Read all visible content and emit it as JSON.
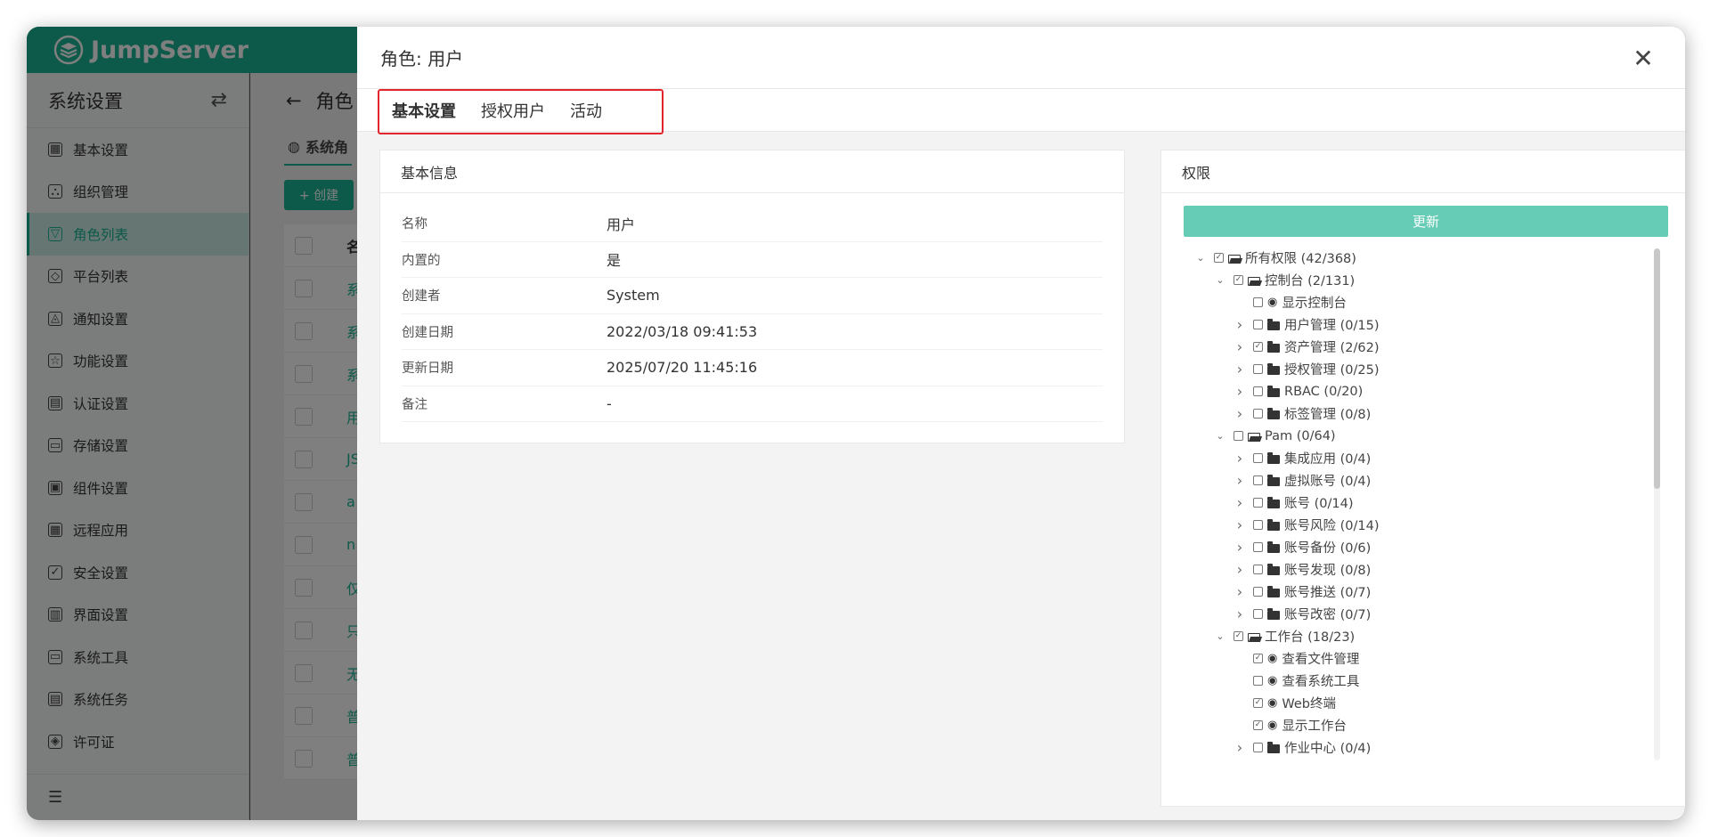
{
  "app": {
    "brand": "JumpServer"
  },
  "sidebar": {
    "title": "系统设置",
    "switch_icon": "swap-icon",
    "items": [
      {
        "label": "基本设置",
        "icon": "grid-icon",
        "active": false
      },
      {
        "label": "组织管理",
        "icon": "org-icon",
        "active": false
      },
      {
        "label": "角色列表",
        "icon": "shirt-icon",
        "active": true
      },
      {
        "label": "平台列表",
        "icon": "cube-icon",
        "active": false
      },
      {
        "label": "通知设置",
        "icon": "bell-icon",
        "active": false
      },
      {
        "label": "功能设置",
        "icon": "star-icon",
        "active": false
      },
      {
        "label": "认证设置",
        "icon": "card-icon",
        "active": false
      },
      {
        "label": "存储设置",
        "icon": "inbox-icon",
        "active": false
      },
      {
        "label": "组件设置",
        "icon": "monitor-icon",
        "active": false
      },
      {
        "label": "远程应用",
        "icon": "apps-icon",
        "active": false
      },
      {
        "label": "安全设置",
        "icon": "shield-icon",
        "active": false
      },
      {
        "label": "界面设置",
        "icon": "layout-icon",
        "active": false
      },
      {
        "label": "系统工具",
        "icon": "toolbox-icon",
        "active": false
      },
      {
        "label": "系统任务",
        "icon": "task-icon",
        "active": false
      },
      {
        "label": "许可证",
        "icon": "license-icon",
        "active": false
      }
    ]
  },
  "main": {
    "back_title": "角色",
    "tab_label": "系统角",
    "create_label": "+ 创建",
    "table_first_chars": [
      "系",
      "系",
      "系",
      "用",
      "JS",
      "a",
      "n",
      "仅",
      "只",
      "无",
      "普",
      "普"
    ],
    "table_header_first_char": "名"
  },
  "drawer": {
    "title": "角色: 用户",
    "tabs": [
      "基本设置",
      "授权用户",
      "活动"
    ],
    "basic_info": {
      "title": "基本信息",
      "rows": [
        {
          "key": "名称",
          "value": "用户"
        },
        {
          "key": "内置的",
          "value": "是"
        },
        {
          "key": "创建者",
          "value": "System"
        },
        {
          "key": "创建日期",
          "value": "2022/03/18 09:41:53"
        },
        {
          "key": "更新日期",
          "value": "2025/07/20 11:45:16"
        },
        {
          "key": "备注",
          "value": "-"
        }
      ]
    },
    "permissions": {
      "title": "权限",
      "update_label": "更新",
      "tree": [
        {
          "level": 0,
          "toggle": "open",
          "checked": true,
          "icon": "folder-open",
          "label": "所有权限 (42/368)"
        },
        {
          "level": 1,
          "toggle": "open",
          "checked": true,
          "icon": "folder-open",
          "label": "控制台 (2/131)"
        },
        {
          "level": 2,
          "toggle": "none",
          "checked": false,
          "icon": "eye",
          "label": "显示控制台"
        },
        {
          "level": 2,
          "toggle": "closed",
          "checked": false,
          "icon": "folder",
          "label": "用户管理 (0/15)"
        },
        {
          "level": 2,
          "toggle": "closed",
          "checked": true,
          "icon": "folder",
          "label": "资产管理 (2/62)"
        },
        {
          "level": 2,
          "toggle": "closed",
          "checked": false,
          "icon": "folder",
          "label": "授权管理 (0/25)"
        },
        {
          "level": 2,
          "toggle": "closed",
          "checked": false,
          "icon": "folder",
          "label": "RBAC (0/20)"
        },
        {
          "level": 2,
          "toggle": "closed",
          "checked": false,
          "icon": "folder",
          "label": "标签管理 (0/8)"
        },
        {
          "level": 1,
          "toggle": "open",
          "checked": false,
          "icon": "folder-open",
          "label": "Pam (0/64)"
        },
        {
          "level": 2,
          "toggle": "closed",
          "checked": false,
          "icon": "folder",
          "label": "集成应用 (0/4)"
        },
        {
          "level": 2,
          "toggle": "closed",
          "checked": false,
          "icon": "folder",
          "label": "虚拟账号 (0/4)"
        },
        {
          "level": 2,
          "toggle": "closed",
          "checked": false,
          "icon": "folder",
          "label": "账号 (0/14)"
        },
        {
          "level": 2,
          "toggle": "closed",
          "checked": false,
          "icon": "folder",
          "label": "账号风险 (0/14)"
        },
        {
          "level": 2,
          "toggle": "closed",
          "checked": false,
          "icon": "folder",
          "label": "账号备份 (0/6)"
        },
        {
          "level": 2,
          "toggle": "closed",
          "checked": false,
          "icon": "folder",
          "label": "账号发现 (0/8)"
        },
        {
          "level": 2,
          "toggle": "closed",
          "checked": false,
          "icon": "folder",
          "label": "账号推送 (0/7)"
        },
        {
          "level": 2,
          "toggle": "closed",
          "checked": false,
          "icon": "folder",
          "label": "账号改密 (0/7)"
        },
        {
          "level": 1,
          "toggle": "open",
          "checked": true,
          "icon": "folder-open",
          "label": "工作台 (18/23)"
        },
        {
          "level": 2,
          "toggle": "none",
          "checked": true,
          "icon": "eye",
          "label": "查看文件管理"
        },
        {
          "level": 2,
          "toggle": "none",
          "checked": false,
          "icon": "eye",
          "label": "查看系统工具"
        },
        {
          "level": 2,
          "toggle": "none",
          "checked": true,
          "icon": "eye",
          "label": "Web终端"
        },
        {
          "level": 2,
          "toggle": "none",
          "checked": true,
          "icon": "eye",
          "label": "显示工作台"
        },
        {
          "level": 2,
          "toggle": "closed",
          "checked": false,
          "icon": "folder",
          "label": "作业中心 (0/4)"
        }
      ]
    }
  }
}
